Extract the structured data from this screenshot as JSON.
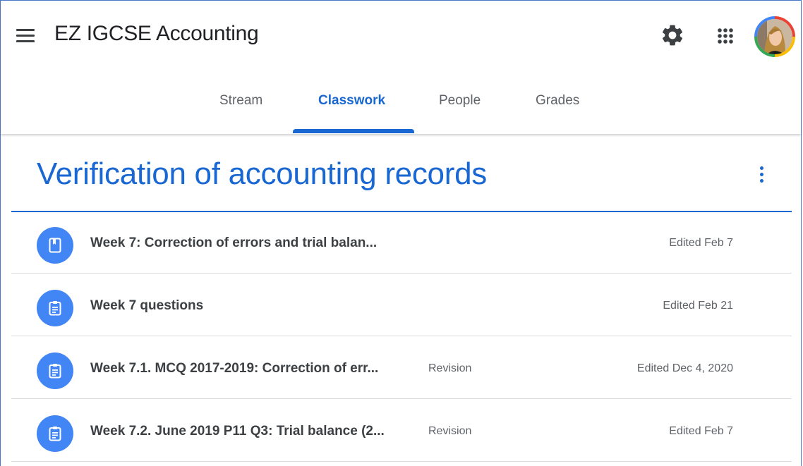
{
  "header": {
    "menu_icon": "hamburger-menu-icon",
    "class_title": "EZ IGCSE Accounting",
    "settings_icon": "gear-icon",
    "apps_icon": "apps-grid-icon",
    "avatar": "user-avatar"
  },
  "tabs": [
    {
      "label": "Stream",
      "active": false
    },
    {
      "label": "Classwork",
      "active": true
    },
    {
      "label": "People",
      "active": false
    },
    {
      "label": "Grades",
      "active": false
    }
  ],
  "topic": {
    "title": "Verification of accounting records",
    "menu_icon": "more-vert-icon"
  },
  "items": [
    {
      "icon": "material-book-icon",
      "title": "Week 7: Correction of errors and trial balan...",
      "topic": "",
      "edited": "Edited Feb 7"
    },
    {
      "icon": "assignment-clipboard-icon",
      "title": "Week 7 questions",
      "topic": "",
      "edited": "Edited Feb 21"
    },
    {
      "icon": "assignment-clipboard-icon",
      "title": "Week 7.1. MCQ 2017-2019: Correction of err...",
      "topic": "Revision",
      "edited": "Edited Dec 4, 2020"
    },
    {
      "icon": "assignment-clipboard-icon",
      "title": "Week 7.2. June 2019 P11 Q3: Trial balance (2...",
      "topic": "Revision",
      "edited": "Edited Feb 7"
    }
  ],
  "colors": {
    "accent": "#1967d2",
    "icon_bg": "#4285f4",
    "text_primary": "#3c4043",
    "text_secondary": "#5f6368",
    "divider": "#dadce0"
  }
}
